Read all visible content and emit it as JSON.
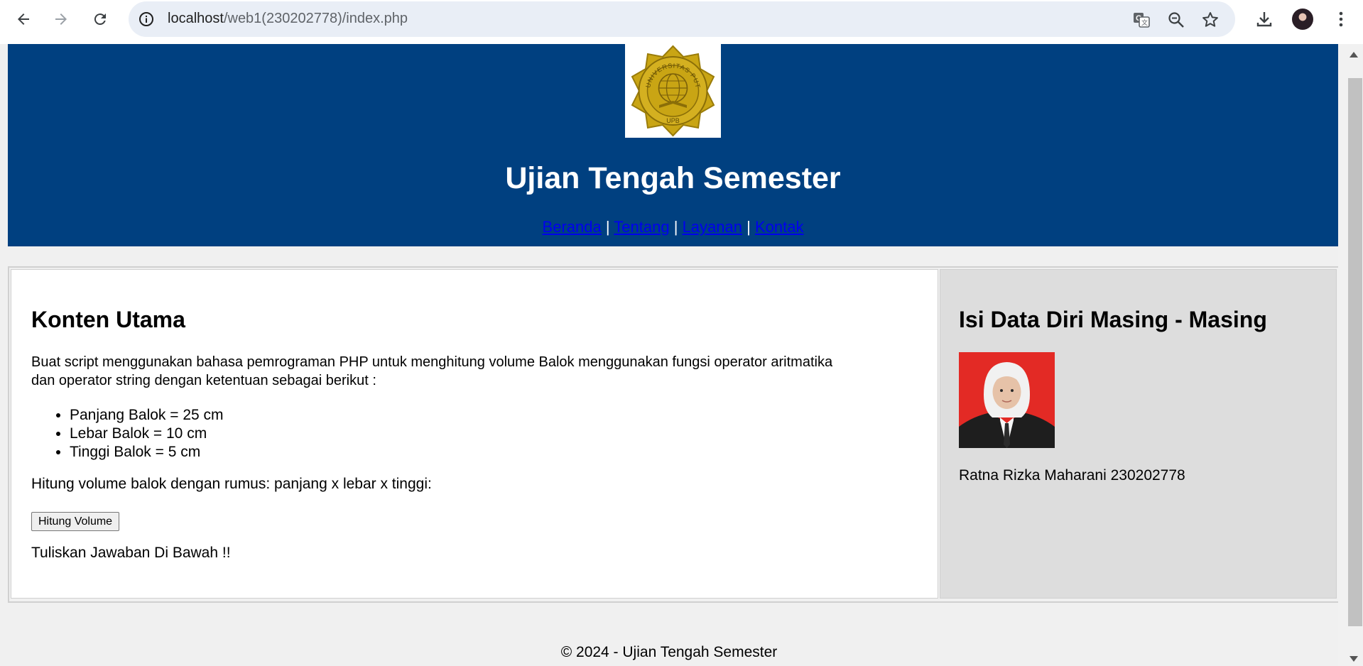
{
  "browser": {
    "url_host": "localhost",
    "url_path": "/web1(230202778)/index.php"
  },
  "header": {
    "title": "Ujian Tengah Semester",
    "logo_text": "UNIVERSITAS PUTRA BANGSA",
    "logo_abbr": "UPB",
    "nav": [
      "Beranda",
      "Tentang",
      "Layanan",
      "Kontak"
    ],
    "separator": "|"
  },
  "main": {
    "heading": "Konten Utama",
    "intro_line1": "Buat script menggunakan bahasa pemrograman PHP untuk menghitung volume Balok menggunakan fungsi operator aritmatika",
    "intro_line2": "dan operator string dengan ketentuan sebagai berikut :",
    "items": [
      "Panjang Balok = 25 cm",
      "Lebar Balok = 10 cm",
      "Tinggi Balok = 5 cm"
    ],
    "formula": "Hitung volume balok dengan rumus: panjang x lebar x tinggi:",
    "button_label": "Hitung Volume",
    "answer_prompt": "Tuliskan Jawaban Di Bawah !!"
  },
  "sidebar": {
    "heading": "Isi Data Diri Masing - Masing",
    "name": "Ratna Rizka Maharani 230202778"
  },
  "footer": {
    "text": "© 2024 - Ujian Tengah Semester"
  },
  "colors": {
    "banner": "#004080",
    "logo_gold": "#c9a514",
    "photo_bg": "#e32a25"
  }
}
